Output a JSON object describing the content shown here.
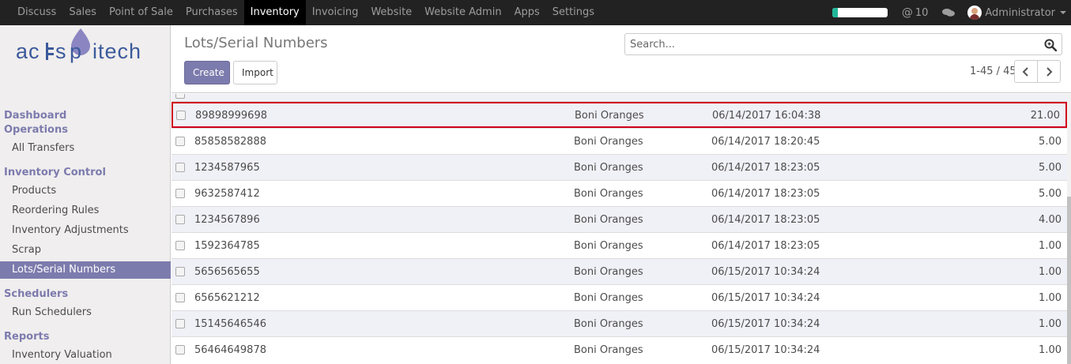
{
  "navbar": {
    "menu": [
      {
        "label": "Discuss",
        "active": false
      },
      {
        "label": "Sales",
        "active": false
      },
      {
        "label": "Point of Sale",
        "active": false
      },
      {
        "label": "Purchases",
        "active": false
      },
      {
        "label": "Inventory",
        "active": true
      },
      {
        "label": "Invoicing",
        "active": false
      },
      {
        "label": "Website",
        "active": false
      },
      {
        "label": "Website Admin",
        "active": false
      },
      {
        "label": "Apps",
        "active": false
      },
      {
        "label": "Settings",
        "active": false
      }
    ],
    "progress_fraction": 0.1,
    "messages_count": "10",
    "user_name": "Administrator"
  },
  "sidebar": {
    "logo_text": "acespritech",
    "sections": [
      {
        "heading": "Dashboard",
        "items": []
      },
      {
        "heading": "Operations",
        "items": [
          {
            "label": "All Transfers",
            "active": false
          }
        ]
      },
      {
        "heading": "Inventory Control",
        "items": [
          {
            "label": "Products",
            "active": false
          },
          {
            "label": "Reordering Rules",
            "active": false
          },
          {
            "label": "Inventory Adjustments",
            "active": false
          },
          {
            "label": "Scrap",
            "active": false
          },
          {
            "label": "Lots/Serial Numbers",
            "active": true
          }
        ]
      },
      {
        "heading": "Schedulers",
        "items": [
          {
            "label": "Run Schedulers",
            "active": false
          }
        ]
      },
      {
        "heading": "Reports",
        "items": [
          {
            "label": "Inventory Valuation",
            "active": false
          }
        ]
      }
    ]
  },
  "control_panel": {
    "title": "Lots/Serial Numbers",
    "create_label": "Create",
    "import_label": "Import",
    "search_placeholder": "Search...",
    "pager_text": "1-45 / 45"
  },
  "list": {
    "rows": [
      {
        "lot": "89898999698",
        "product": "Boni Oranges",
        "date": "06/14/2017 16:04:38",
        "qty": "21.00",
        "highlighted": true
      },
      {
        "lot": "85858582888",
        "product": "Boni Oranges",
        "date": "06/14/2017 18:20:45",
        "qty": "5.00",
        "highlighted": false
      },
      {
        "lot": "1234587965",
        "product": "Boni Oranges",
        "date": "06/14/2017 18:23:05",
        "qty": "5.00",
        "highlighted": false
      },
      {
        "lot": "9632587412",
        "product": "Boni Oranges",
        "date": "06/14/2017 18:23:05",
        "qty": "5.00",
        "highlighted": false
      },
      {
        "lot": "1234567896",
        "product": "Boni Oranges",
        "date": "06/14/2017 18:23:05",
        "qty": "4.00",
        "highlighted": false
      },
      {
        "lot": "1592364785",
        "product": "Boni Oranges",
        "date": "06/14/2017 18:23:05",
        "qty": "1.00",
        "highlighted": false
      },
      {
        "lot": "5656565655",
        "product": "Boni Oranges",
        "date": "06/15/2017 10:34:24",
        "qty": "1.00",
        "highlighted": false
      },
      {
        "lot": "6565621212",
        "product": "Boni Oranges",
        "date": "06/15/2017 10:34:24",
        "qty": "1.00",
        "highlighted": false
      },
      {
        "lot": "15145646546",
        "product": "Boni Oranges",
        "date": "06/15/2017 10:34:24",
        "qty": "1.00",
        "highlighted": false
      },
      {
        "lot": "56464649878",
        "product": "Boni Oranges",
        "date": "06/15/2017 10:34:24",
        "qty": "1.00",
        "highlighted": false
      }
    ]
  },
  "colors": {
    "brand": "#7c7bad",
    "navbar_bg": "#222222",
    "highlight_border": "#d0021b",
    "progress_fill": "#21b799"
  }
}
